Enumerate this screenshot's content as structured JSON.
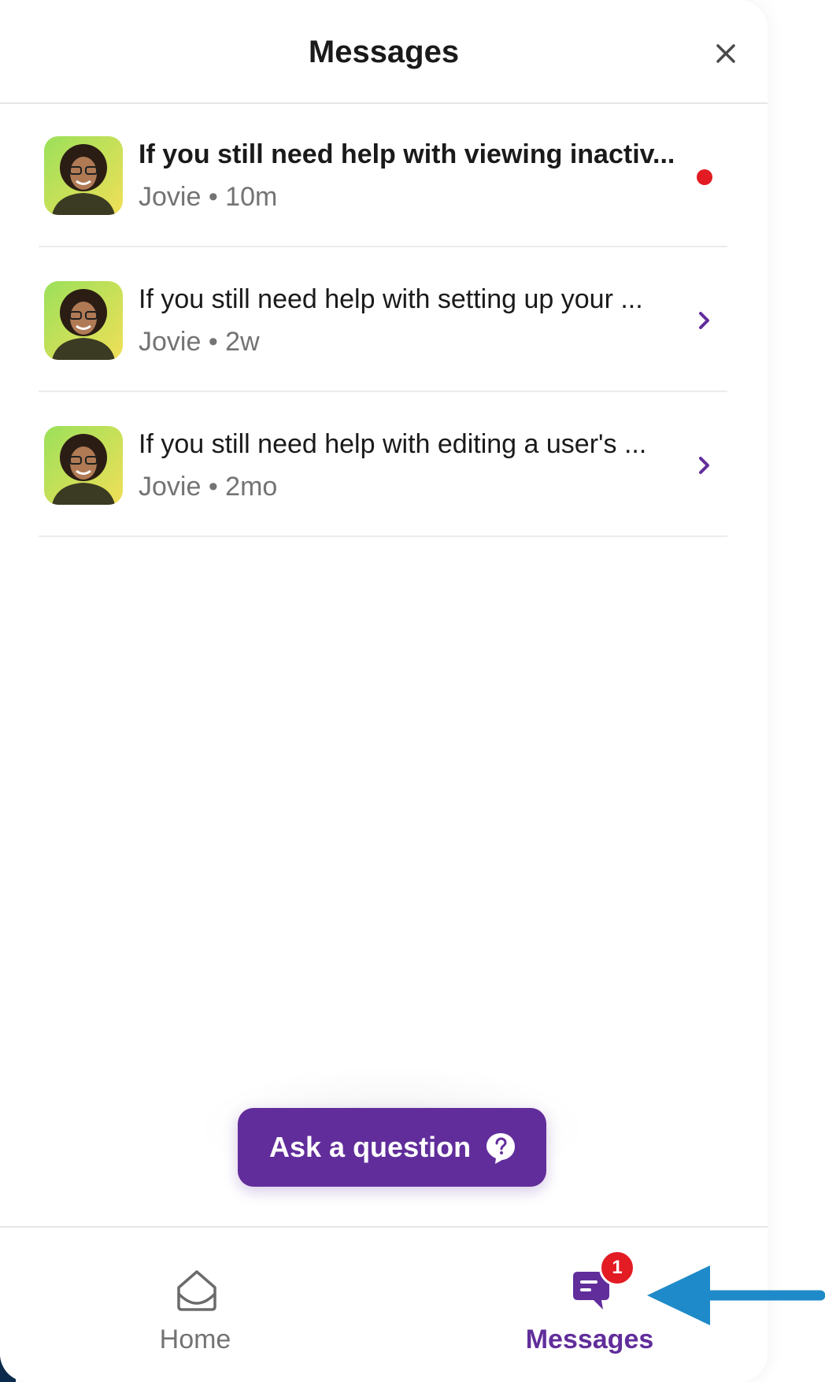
{
  "header": {
    "title": "Messages"
  },
  "conversations": [
    {
      "title": "If you still need help with viewing inactiv...",
      "meta": "Jovie • 10m",
      "unread": true
    },
    {
      "title": "If you still need help with setting up your ...",
      "meta": "Jovie • 2w",
      "unread": false
    },
    {
      "title": "If you still need help with editing a user's ...",
      "meta": "Jovie • 2mo",
      "unread": false
    }
  ],
  "ask_button": {
    "label": "Ask a question"
  },
  "bottom_nav": {
    "home_label": "Home",
    "messages_label": "Messages",
    "messages_badge": "1"
  },
  "colors": {
    "accent": "#612d9b",
    "unread_dot": "#e31b23",
    "badge": "#e31b23",
    "pointer_arrow": "#1f8ac9"
  },
  "icons": {
    "close": "close-icon",
    "chevron": "chevron-right-icon",
    "question": "question-bubble-icon",
    "home": "home-icon",
    "messages": "messages-icon",
    "pointer": "arrow-left-icon"
  }
}
